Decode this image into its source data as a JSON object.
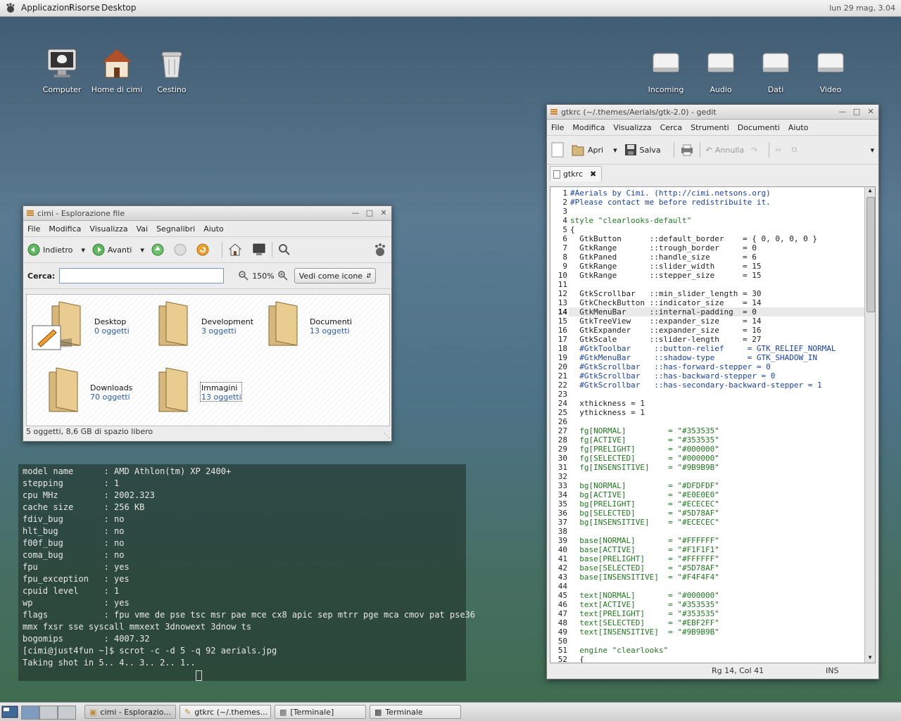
{
  "top_panel": {
    "menus": [
      "Applicazioni",
      "Risorse",
      "Desktop"
    ],
    "clock": "lun 29 mag,  3.04"
  },
  "desktop_icons": {
    "left": [
      "Computer",
      "Home di cimi",
      "Cestino"
    ],
    "right": [
      "Incoming",
      "Audio",
      "Dati",
      "Video"
    ]
  },
  "file_manager": {
    "title": "cimi - Esplorazione file",
    "menus": [
      "File",
      "Modifica",
      "Visualizza",
      "Vai",
      "Segnalibri",
      "Aiuto"
    ],
    "back_label": "Indietro",
    "forward_label": "Avanti",
    "search_label": "Cerca:",
    "search_value": "",
    "zoom": "150%",
    "view_mode": "Vedi come icone",
    "folders": [
      {
        "name": "Desktop",
        "count": "0 oggetti"
      },
      {
        "name": "Development",
        "count": "3 oggetti"
      },
      {
        "name": "Documenti",
        "count": "13 oggetti"
      },
      {
        "name": "Downloads",
        "count": "70 oggetti"
      },
      {
        "name": "Immagini",
        "count": "13 oggetti"
      }
    ],
    "status": "5 oggetti, 8,6 GB di spazio libero"
  },
  "terminal": {
    "lines": [
      "model name      : AMD Athlon(tm) XP 2400+",
      "stepping        : 1",
      "cpu MHz         : 2002.323",
      "cache size      : 256 KB",
      "fdiv_bug        : no",
      "hlt_bug         : no",
      "f00f_bug        : no",
      "coma_bug        : no",
      "fpu             : yes",
      "fpu_exception   : yes",
      "cpuid level     : 1",
      "wp              : yes",
      "flags           : fpu vme de pse tsc msr pae mce cx8 apic sep mtrr pge mca cmov pat pse36",
      "mmx fxsr sse syscall mmxext 3dnowext 3dnow ts",
      "bogomips        : 4007.32",
      "",
      "[cimi@just4fun ~]$ scrot -c -d 5 -q 92 aerials.jpg",
      "Taking shot in 5.. 4.. 3.. 2.. 1.. "
    ]
  },
  "gedit": {
    "title": "gtkrc (~/.themes/Aerials/gtk-2.0) - gedit",
    "menus": [
      "File",
      "Modifica",
      "Visualizza",
      "Cerca",
      "Strumenti",
      "Documenti",
      "Aiuto"
    ],
    "open_label": "Apri",
    "save_label": "Salva",
    "undo_label": "Annulla",
    "tab_label": "gtkrc",
    "lines": [
      "#Aerials by Cimi. (http://cimi.netsons.org)",
      "#Please contact me before redistribuite it.",
      "",
      "style \"clearlooks-default\"",
      "{",
      "  GtkButton      ::default_border    = { 0, 0, 0, 0 }",
      "  GtkRange       ::trough_border     = 0",
      "  GtkPaned       ::handle_size       = 6",
      "  GtkRange       ::slider_width      = 15",
      "  GtkRange       ::stepper_size      = 15",
      "",
      "  GtkScrollbar   ::min_slider_length = 30",
      "  GtkCheckButton ::indicator_size    = 14",
      "  GtkMenuBar     ::internal-padding  = 0",
      "  GtkTreeView    ::expander_size     = 14",
      "  GtkExpander    ::expander_size     = 16",
      "  GtkScale       ::slider-length     = 27",
      "  #GtkToolbar     ::button-relief     = GTK_RELIEF_NORMAL",
      "  #GtkMenuBar     ::shadow-type       = GTK_SHADOW_IN",
      "  #GtkScrollbar   ::has-forward-stepper = 0",
      "  #GtkScrollbar   ::has-backward-stepper = 0",
      "  #GtkScrollbar   ::has-secondary-backward-stepper = 1",
      "",
      "  xthickness = 1",
      "  ythickness = 1",
      "",
      "  fg[NORMAL]         = \"#353535\"",
      "  fg[ACTIVE]         = \"#353535\"",
      "  fg[PRELIGHT]       = \"#000000\"",
      "  fg[SELECTED]       = \"#000000\"",
      "  fg[INSENSITIVE]    = \"#9B9B9B\"",
      "",
      "  bg[NORMAL]         = \"#DFDFDF\"",
      "  bg[ACTIVE]         = \"#E0E0E0\"",
      "  bg[PRELIGHT]       = \"#ECECEC\"",
      "  bg[SELECTED]       = \"#5D78AF\"",
      "  bg[INSENSITIVE]    = \"#ECECEC\"",
      "",
      "  base[NORMAL]       = \"#FFFFFF\"",
      "  base[ACTIVE]       = \"#F1F1F1\"",
      "  base[PRELIGHT]     = \"#FFFFFF\"",
      "  base[SELECTED]     = \"#5D78AF\"",
      "  base[INSENSITIVE]  = \"#F4F4F4\"",
      "",
      "  text[NORMAL]       = \"#000000\"",
      "  text[ACTIVE]       = \"#353535\"",
      "  text[PRELIGHT]     = \"#353535\"",
      "  text[SELECTED]     = \"#EBF2FF\"",
      "  text[INSENSITIVE]  = \"#9B9B9B\"",
      "",
      "  engine \"clearlooks\"",
      "  {"
    ],
    "current_line": 14,
    "status_position": "Rg 14, Col 41",
    "status_mode": "INS"
  },
  "taskbar": {
    "tasks": [
      "cimi - Esplorazio...",
      "gtkrc (~/.themes...",
      "[Terminale]",
      "Terminale"
    ]
  },
  "colors": {
    "comment": "#1a3fb0",
    "string": "#b000b0",
    "number": "#b000b0",
    "keyword": "#1f7a1f",
    "highlight": "#e9e9e9"
  }
}
